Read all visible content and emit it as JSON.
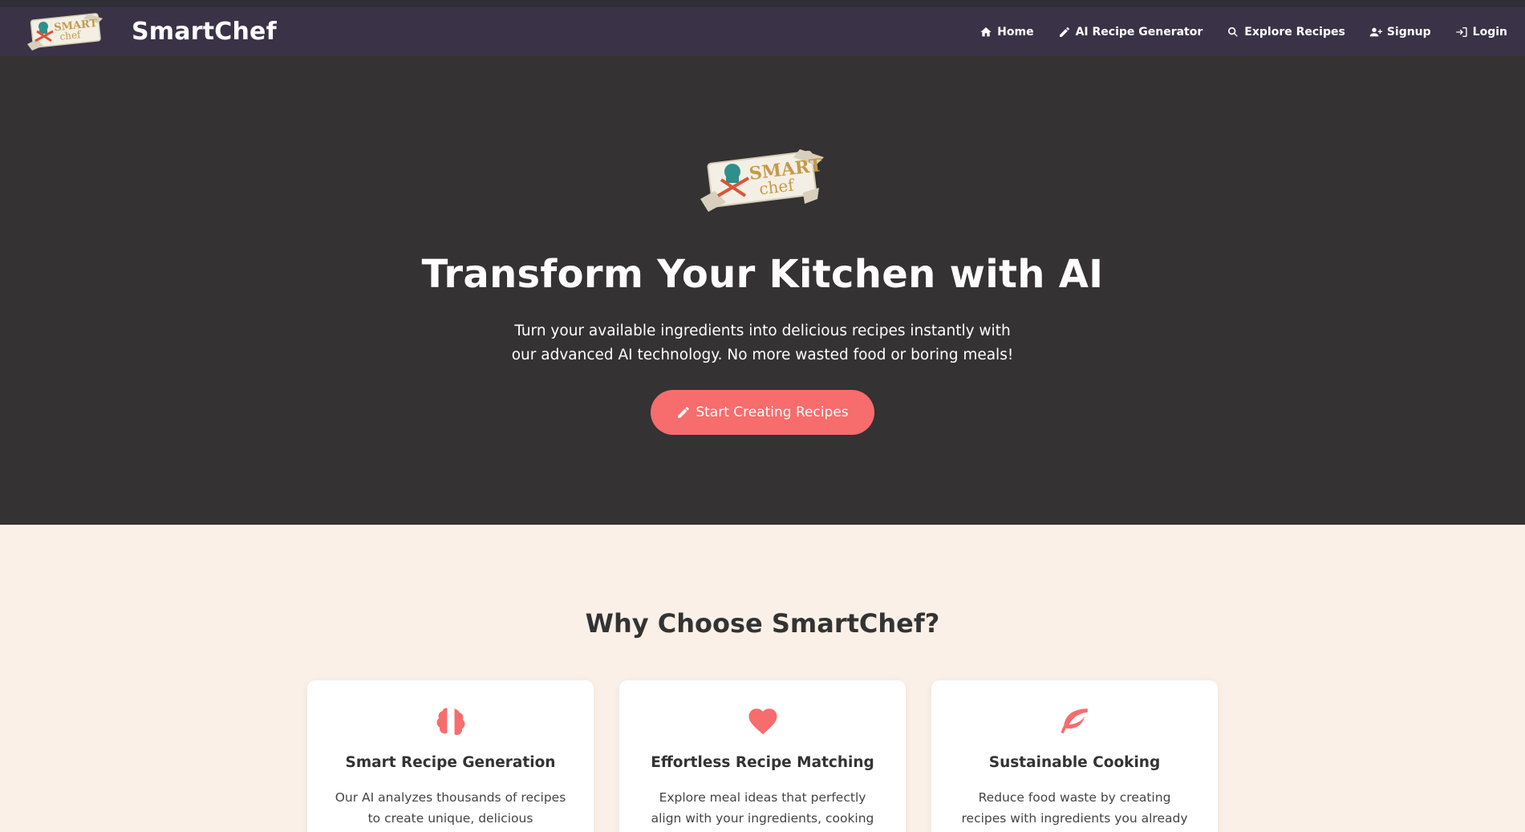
{
  "colors": {
    "navbar_bg": "#3a3347",
    "hero_bg": "#343232",
    "accent": "#f76c6c",
    "section_bg": "#faf0e8",
    "logo_text": "#c49a4b",
    "logo_hat": "#2f8f8a"
  },
  "brand": {
    "name": "SmartChef",
    "logo_word_top": "SMART",
    "logo_word_bottom": "chef"
  },
  "nav": {
    "items": [
      {
        "label": "Home",
        "icon": "home-icon"
      },
      {
        "label": "AI Recipe Generator",
        "icon": "pencil-icon"
      },
      {
        "label": "Explore Recipes",
        "icon": "search-icon"
      },
      {
        "label": "Signup",
        "icon": "user-plus-icon"
      },
      {
        "label": "Login",
        "icon": "login-icon"
      }
    ]
  },
  "hero": {
    "title": "Transform Your Kitchen with AI",
    "subtitle": "Turn your available ingredients into delicious recipes instantly with our advanced AI technology. No more wasted food or boring meals!",
    "cta_label": "Start Creating Recipes",
    "cta_icon": "pencil-icon"
  },
  "features": {
    "title": "Why Choose SmartChef?",
    "cards": [
      {
        "icon": "brain-icon",
        "title": "Smart Recipe Generation",
        "text": "Our AI analyzes thousands of recipes to create unique, delicious combinations"
      },
      {
        "icon": "heart-icon",
        "title": "Effortless Recipe Matching",
        "text": "Explore meal ideas that perfectly align with your ingredients, cooking time, and"
      },
      {
        "icon": "leaf-icon",
        "title": "Sustainable Cooking",
        "text": "Reduce food waste by creating recipes with ingredients you already have in your"
      }
    ]
  }
}
